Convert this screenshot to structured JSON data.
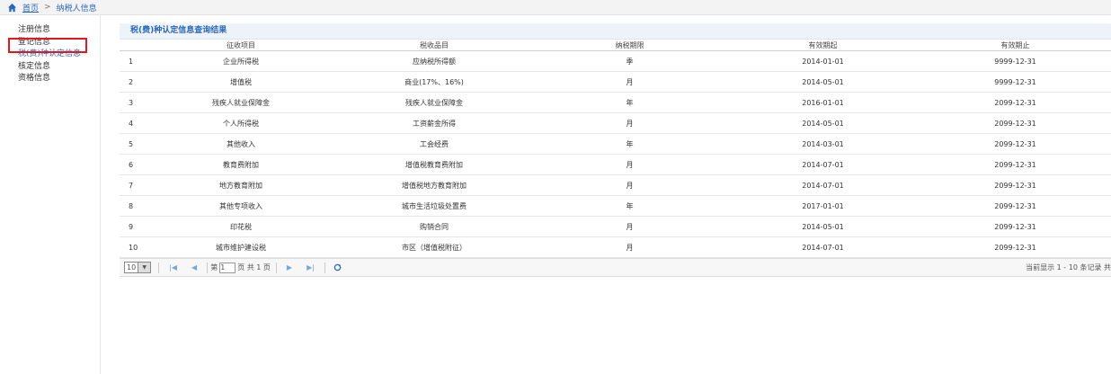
{
  "breadcrumb": {
    "home": "首页",
    "separator": ">",
    "current": "纳税人信息"
  },
  "sidebar": {
    "items": [
      {
        "label": "注册信息"
      },
      {
        "label": "登记信息"
      },
      {
        "label": "税(费)种认定信息"
      },
      {
        "label": "核定信息"
      },
      {
        "label": "资格信息"
      }
    ],
    "highlight_color": "#e0191f"
  },
  "panel": {
    "title": "税(费)种认定信息查询结果"
  },
  "table": {
    "headers": [
      "",
      "征收项目",
      "税收品目",
      "纳税期限",
      "有效期起",
      "有效期止"
    ],
    "rows": [
      [
        "1",
        "企业所得税",
        "应纳税所得额",
        "季",
        "2014-01-01",
        "9999-12-31"
      ],
      [
        "2",
        "增值税",
        "商业(17%、16%)",
        "月",
        "2014-05-01",
        "9999-12-31"
      ],
      [
        "3",
        "残疾人就业保障金",
        "残疾人就业保障金",
        "年",
        "2016-01-01",
        "2099-12-31"
      ],
      [
        "4",
        "个人所得税",
        "工资薪金所得",
        "月",
        "2014-05-01",
        "2099-12-31"
      ],
      [
        "5",
        "其他收入",
        "工会经费",
        "年",
        "2014-03-01",
        "2099-12-31"
      ],
      [
        "6",
        "教育费附加",
        "增值税教育费附加",
        "月",
        "2014-07-01",
        "2099-12-31"
      ],
      [
        "7",
        "地方教育附加",
        "增值税地方教育附加",
        "月",
        "2014-07-01",
        "2099-12-31"
      ],
      [
        "8",
        "其他专项收入",
        "城市生活垃圾处置费",
        "年",
        "2017-01-01",
        "2099-12-31"
      ],
      [
        "9",
        "印花税",
        "购销合同",
        "月",
        "2014-05-01",
        "2099-12-31"
      ],
      [
        "10",
        "城市维护建设税",
        "市区（增值税附征）",
        "月",
        "2014-07-01",
        "2099-12-31"
      ]
    ]
  },
  "pager": {
    "page_size": "10",
    "page_prefix": "第",
    "page_value": "1",
    "page_suffix": "页 共 1 页",
    "info": "当前显示 1 - 10 条记录 共"
  },
  "icons": {
    "home": "home-icon",
    "refresh": "refresh-icon"
  },
  "colors": {
    "link": "#2b67b5",
    "header_bg": "#eef3fa"
  }
}
